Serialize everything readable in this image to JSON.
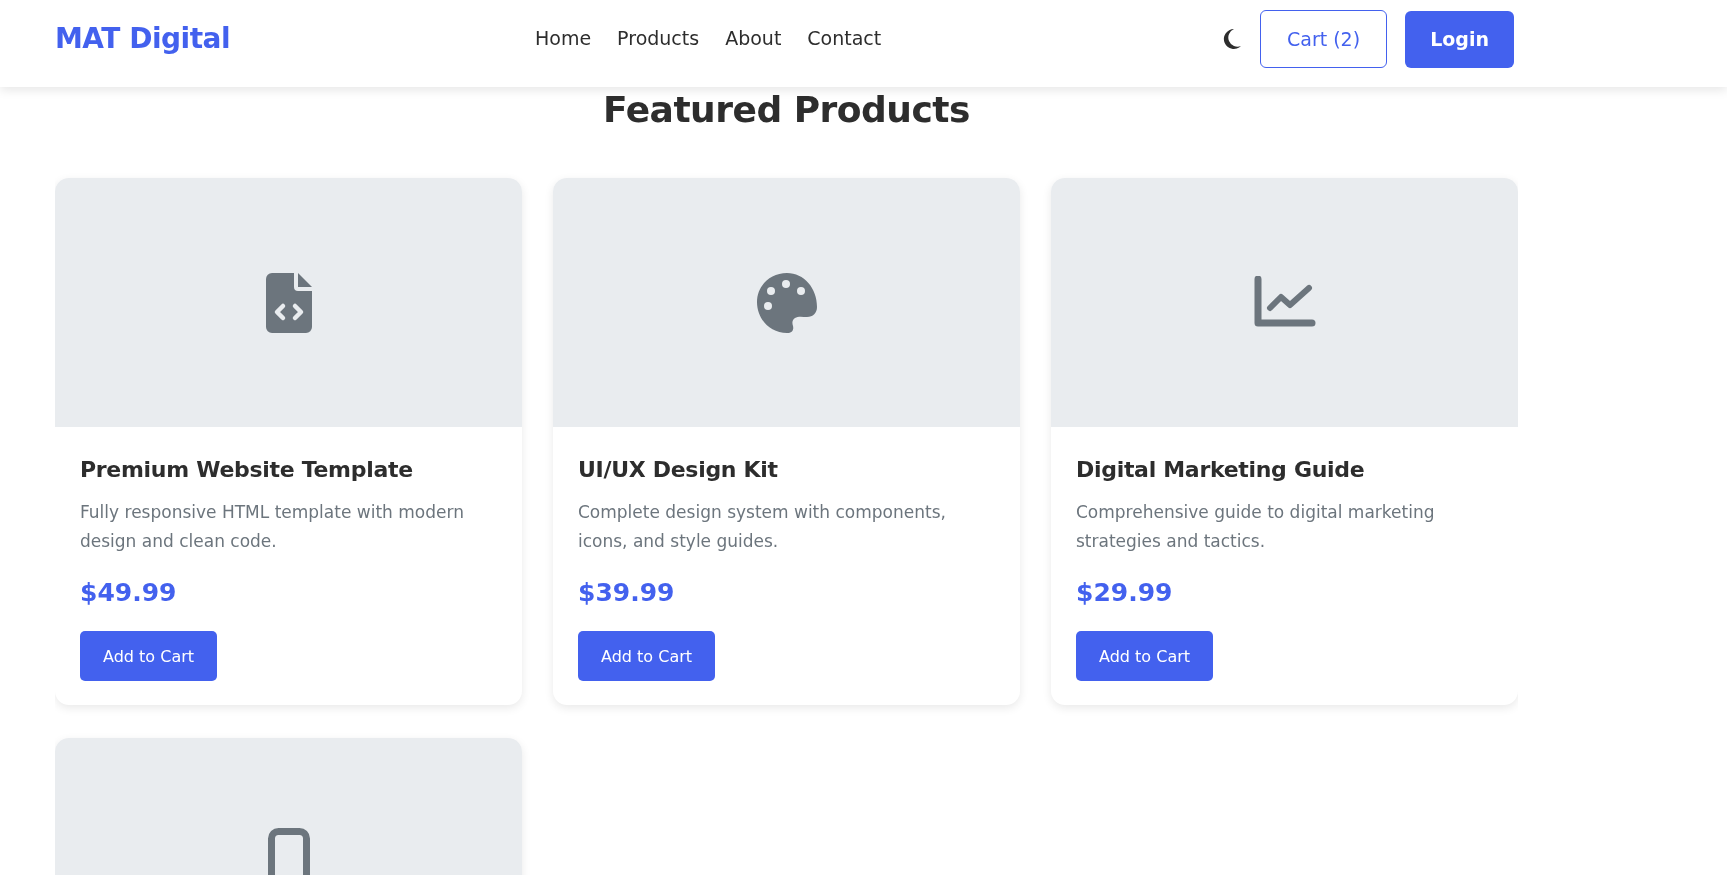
{
  "header": {
    "logo": "MAT Digital",
    "nav": [
      {
        "label": "Home"
      },
      {
        "label": "Products"
      },
      {
        "label": "About"
      },
      {
        "label": "Contact"
      }
    ],
    "cart_button": "Cart (2)",
    "login_button": "Login"
  },
  "heading": "Featured Products",
  "products": [
    {
      "kind": "file-code",
      "title": "Premium Website Template",
      "description": "Fully responsive HTML template with modern design and clean code.",
      "price": "$49.99",
      "button": "Add to Cart"
    },
    {
      "kind": "palette",
      "title": "UI/UX Design Kit",
      "description": "Complete design system with components, icons, and style guides.",
      "price": "$39.99",
      "button": "Add to Cart"
    },
    {
      "kind": "chart-line",
      "title": "Digital Marketing Guide",
      "description": "Comprehensive guide to digital marketing strategies and tactics.",
      "price": "$29.99",
      "button": "Add to Cart"
    },
    {
      "kind": "mobile"
    }
  ]
}
